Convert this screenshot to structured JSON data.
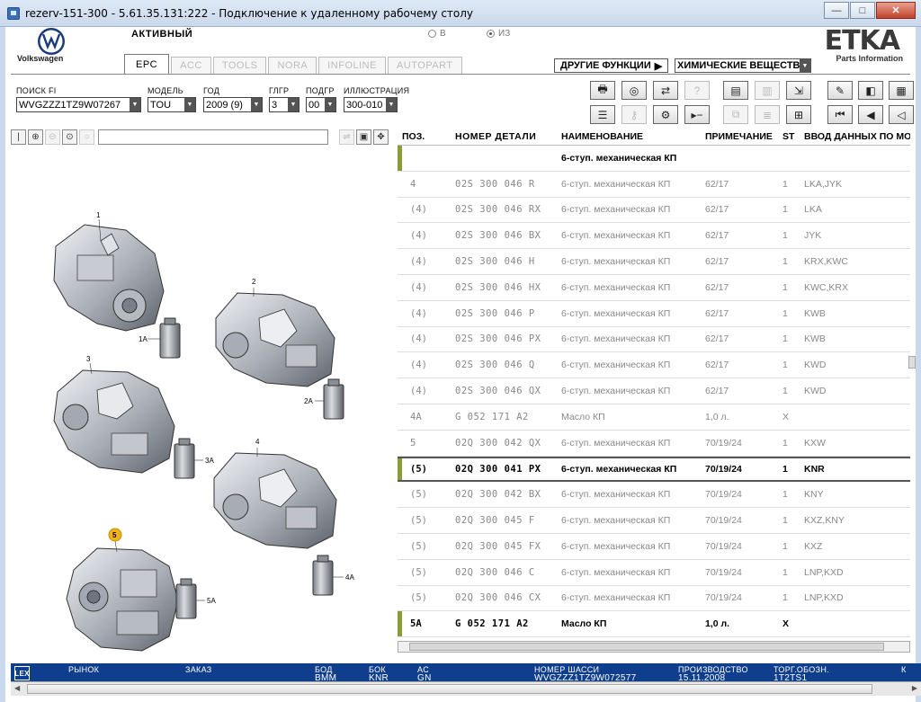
{
  "window": {
    "title": "rezerv-151-300 - 5.61.35.131:222 - Подключение к удаленному рабочему столу",
    "btn_min": "—",
    "btn_max": "□",
    "btn_close": "✕"
  },
  "header": {
    "brand": "Volkswagen",
    "status": "АКТИВНЫЙ",
    "radio_in": "В",
    "radio_from": "ИЗ",
    "logo": "ETKA",
    "logo_sub": "Parts Information"
  },
  "tabs": [
    "EPC",
    "ACC",
    "TOOLS",
    "NORA",
    "INFOLINE",
    "AUTOPART"
  ],
  "other_functions": "ДРУГИЕ ФУНКЦИИ",
  "chem_select": "ХИМИЧЕСКИЕ ВЕЩЕСТВ",
  "fields": {
    "search_fi": {
      "label": "ПОИСК FI",
      "value": "WVGZZZ1TZ9W07267"
    },
    "model": {
      "label": "МОДЕЛЬ",
      "value": "TOU"
    },
    "year": {
      "label": "ГОД",
      "value": "2009 (9)"
    },
    "mgroup": {
      "label": "ГЛГР",
      "value": "3"
    },
    "subgroup": {
      "label": "ПОДГР",
      "value": "00"
    },
    "illustration": {
      "label": "ИЛЛЮСТРАЦИЯ",
      "value": "300-010"
    }
  },
  "illustration": {
    "callouts": [
      "1",
      "1A",
      "2",
      "2A",
      "3",
      "3A",
      "4",
      "4A",
      "5",
      "5A"
    ],
    "highlight_color": "#f2b21a"
  },
  "table": {
    "headers": {
      "pos": "ПОЗ.",
      "part": "НОМЕР ДЕТАЛИ",
      "name": "НАИМЕНОВАНИЕ",
      "note": "ПРИМЕЧАНИЕ",
      "st": "ST",
      "data": "ВВОД ДАННЫХ ПО МО"
    },
    "rows": [
      {
        "pos": "",
        "part": "",
        "name": "6-ступ. механическая КП",
        "note": "",
        "st": "",
        "data": "",
        "style": "head"
      },
      {
        "pos": "4",
        "part": "02S 300 046 R",
        "name": "6-ступ. механическая КП",
        "note": "62/17",
        "st": "1",
        "data": "LKA,JYK",
        "style": "dim"
      },
      {
        "pos": "(4)",
        "part": "02S 300 046 RX",
        "name": "6-ступ. механическая КП",
        "note": "62/17",
        "st": "1",
        "data": "LKA",
        "style": "dim"
      },
      {
        "pos": "(4)",
        "part": "02S 300 046 BX",
        "name": "6-ступ. механическая КП",
        "note": "62/17",
        "st": "1",
        "data": "JYK",
        "style": "dim"
      },
      {
        "pos": "(4)",
        "part": "02S 300 046 H",
        "name": "6-ступ. механическая КП",
        "note": "62/17",
        "st": "1",
        "data": "KRX,KWC",
        "style": "dim"
      },
      {
        "pos": "(4)",
        "part": "02S 300 046 HX",
        "name": "6-ступ. механическая КП",
        "note": "62/17",
        "st": "1",
        "data": "KWC,KRX",
        "style": "dim"
      },
      {
        "pos": "(4)",
        "part": "02S 300 046 P",
        "name": "6-ступ. механическая КП",
        "note": "62/17",
        "st": "1",
        "data": "KWB",
        "style": "dim"
      },
      {
        "pos": "(4)",
        "part": "02S 300 046 PX",
        "name": "6-ступ. механическая КП",
        "note": "62/17",
        "st": "1",
        "data": "KWB",
        "style": "dim"
      },
      {
        "pos": "(4)",
        "part": "02S 300 046 Q",
        "name": "6-ступ. механическая КП",
        "note": "62/17",
        "st": "1",
        "data": "KWD",
        "style": "dim"
      },
      {
        "pos": "(4)",
        "part": "02S 300 046 QX",
        "name": "6-ступ. механическая КП",
        "note": "62/17",
        "st": "1",
        "data": "KWD",
        "style": "dim"
      },
      {
        "pos": "4A",
        "part": "G  052 171 A2",
        "name": "Масло КП",
        "note": "1,0 л.",
        "st": "X",
        "data": "",
        "style": "dim"
      },
      {
        "pos": "5",
        "part": "02Q 300 042 QX",
        "name": "6-ступ. механическая КП",
        "note": "70/19/24",
        "st": "1",
        "data": "KXW",
        "style": "dim"
      },
      {
        "pos": "(5)",
        "part": "02Q 300 041 PX",
        "name": "6-ступ. механическая КП",
        "note": "70/19/24",
        "st": "1",
        "data": "KNR",
        "style": "bold"
      },
      {
        "pos": "(5)",
        "part": "02Q 300 042 BX",
        "name": "6-ступ. механическая КП",
        "note": "70/19/24",
        "st": "1",
        "data": "KNY",
        "style": "dim"
      },
      {
        "pos": "(5)",
        "part": "02Q 300 045 F",
        "name": "6-ступ. механическая КП",
        "note": "70/19/24",
        "st": "1",
        "data": "KXZ,KNY",
        "style": "dim"
      },
      {
        "pos": "(5)",
        "part": "02Q 300 045 FX",
        "name": "6-ступ. механическая КП",
        "note": "70/19/24",
        "st": "1",
        "data": "KXZ",
        "style": "dim"
      },
      {
        "pos": "(5)",
        "part": "02Q 300 046 C",
        "name": "6-ступ. механическая КП",
        "note": "70/19/24",
        "st": "1",
        "data": "LNP,KXD",
        "style": "dim"
      },
      {
        "pos": "(5)",
        "part": "02Q 300 046 CX",
        "name": "6-ступ. механическая КП",
        "note": "70/19/24",
        "st": "1",
        "data": "LNP,KXD",
        "style": "dim"
      },
      {
        "pos": "5A",
        "part": "G  052 171 A2",
        "name": "Масло КП",
        "note": "1,0 л.",
        "st": "X",
        "data": "",
        "style": "black"
      }
    ]
  },
  "statusbar": {
    "lex": "LEX",
    "market": "РЫНОК",
    "order": "ЗАКАЗ",
    "bod_label": "БОД",
    "bod_value": "BMM",
    "bok_label": "БОК",
    "bok_value": "KNR",
    "ac_label": "AC",
    "ac_value": "GN",
    "chassis_label": "НОМЕР ШАССИ",
    "chassis_value": "WVGZZZ1TZ9W072577",
    "production_label": "ПРОИЗВОДСТВО",
    "production_value": "15.11.2008",
    "trade_label": "ТОРГ.ОБОЗН.",
    "trade_value": "1T2TS1",
    "k_label": "К"
  },
  "accent": {
    "marker": "#8a9c38",
    "statusbar": "#0f3f8c"
  }
}
